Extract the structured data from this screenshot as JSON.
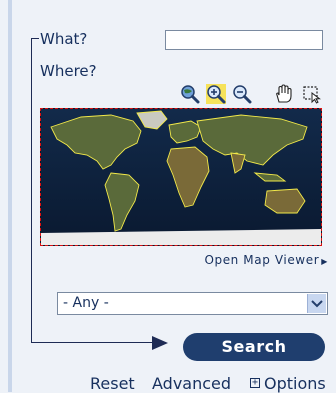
{
  "form": {
    "what_label": "What?",
    "what_value": "",
    "where_label": "Where?"
  },
  "map_tools": [
    {
      "icon": "zoom-globe-icon"
    },
    {
      "icon": "zoom-in-icon",
      "active": true
    },
    {
      "icon": "zoom-out-icon"
    },
    {
      "icon": "pan-hand-icon"
    },
    {
      "icon": "select-region-icon"
    }
  ],
  "map": {
    "link_text": "Open Map Viewer",
    "link_icon": "chevron-right-icon"
  },
  "select": {
    "value": "- Any -"
  },
  "buttons": {
    "search_label": "Search"
  },
  "footer": {
    "reset": "Reset",
    "advanced": "Advanced",
    "options": "Options"
  },
  "colors": {
    "accent": "#1f3e6e",
    "text": "#17305e",
    "map_border": "#dd1111",
    "map_outline": "#f2e94a"
  }
}
